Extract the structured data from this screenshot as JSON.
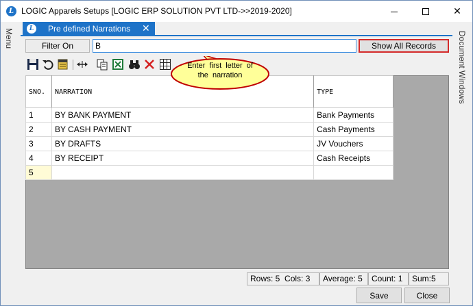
{
  "window": {
    "title": "LOGIC Apparels Setups  [LOGIC ERP SOLUTION PVT LTD->>2019-2020]",
    "icon_letter": "L",
    "buttons": {
      "minimize": "minimize-icon",
      "maximize": "maximize-icon",
      "close": "✕"
    }
  },
  "side": {
    "left_label": "Menu",
    "right_label": "Document Windows"
  },
  "tab": {
    "label": "Pre defined Narrations",
    "icon_letter": "L",
    "close": "✕"
  },
  "filter": {
    "label": "Filter On",
    "value": "B",
    "show_all_label": "Show All Records"
  },
  "toolbar": {
    "icons": [
      "save-icon",
      "undo-icon",
      "notes-icon",
      "resize-columns-icon",
      "copy-icon",
      "excel-icon",
      "find-icon",
      "delete-icon",
      "grid-icon"
    ]
  },
  "callout": {
    "line1": "Enter first letter of",
    "line2": "the narration"
  },
  "grid": {
    "columns": [
      "SNO.",
      "NARRATION",
      "TYPE"
    ],
    "rows": [
      {
        "sno": "1",
        "narration": "BY BANK PAYMENT",
        "type": "Bank Payments"
      },
      {
        "sno": "2",
        "narration": "BY CASH PAYMENT",
        "type": "Cash Payments"
      },
      {
        "sno": "3",
        "narration": "BY DRAFTS",
        "type": "JV Vouchers"
      },
      {
        "sno": "4",
        "narration": "BY RECEIPT",
        "type": "Cash Receipts"
      },
      {
        "sno": "5",
        "narration": "",
        "type": ""
      }
    ]
  },
  "status": {
    "rows": "Rows: 5",
    "cols": "Cols: 3",
    "average": "Average: 5",
    "count": "Count: 1",
    "sum": "Sum:5"
  },
  "footer": {
    "save_label": "Save",
    "close_label": "Close"
  },
  "colors": {
    "accent": "#1e73c8",
    "highlight_border": "#d42a2a",
    "callout_fill": "#ffff99",
    "callout_border": "#c00000"
  }
}
